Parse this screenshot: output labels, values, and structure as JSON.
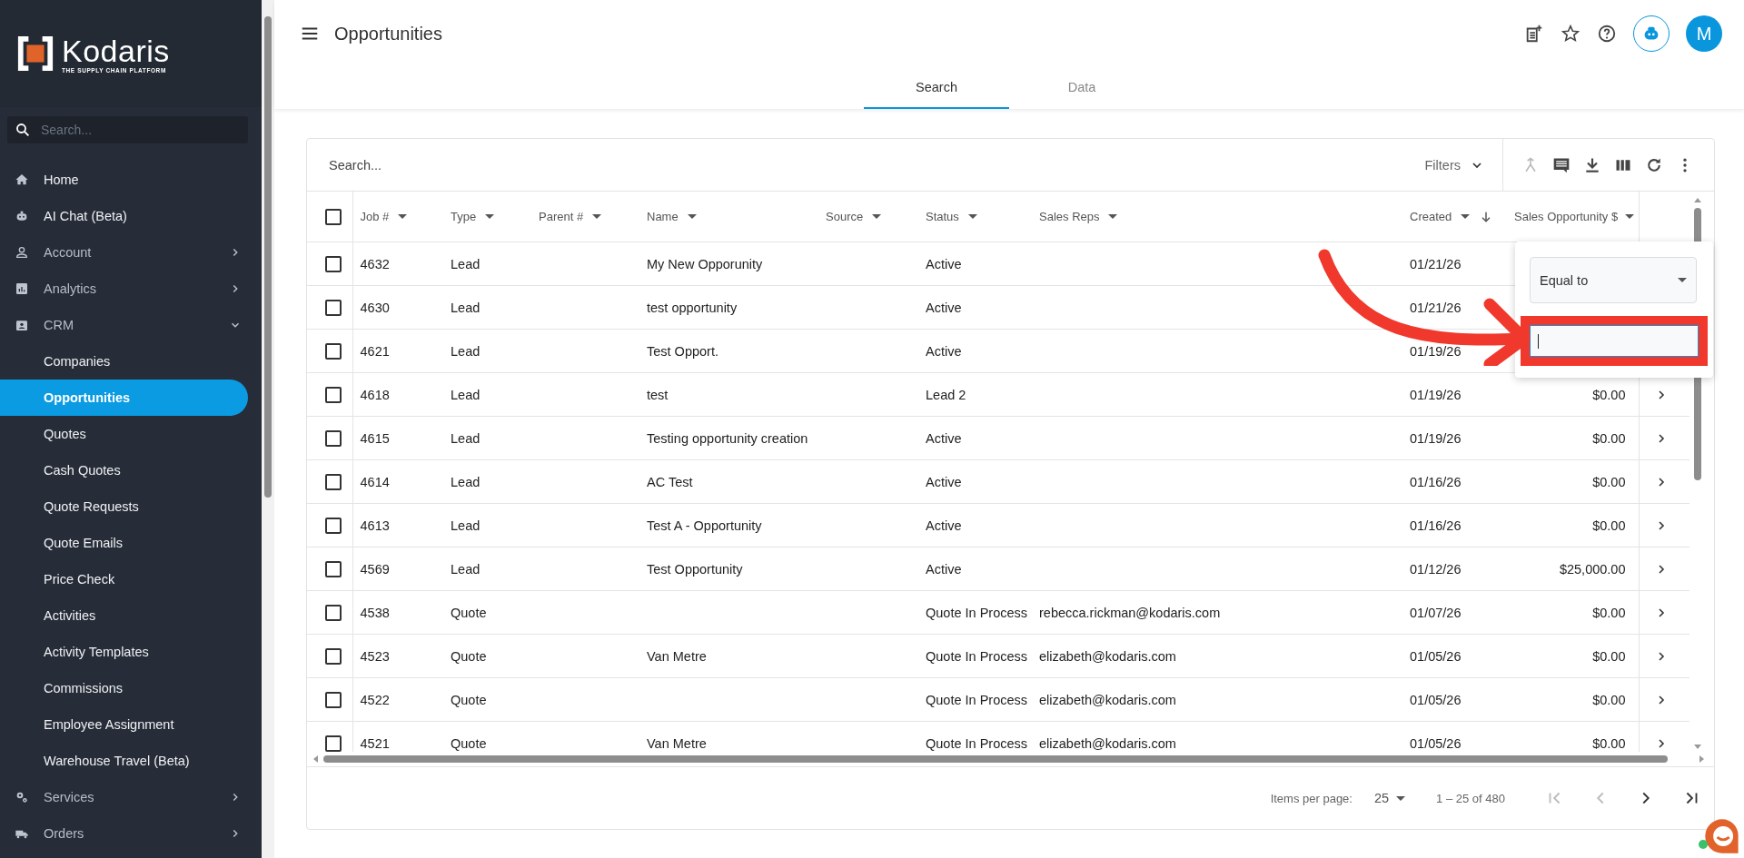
{
  "sidebar": {
    "logo": {
      "name": "Kodaris",
      "tagline": "THE SUPPLY CHAIN PLATFORM"
    },
    "search": {
      "placeholder": "Search..."
    },
    "items": [
      {
        "label": "Home",
        "selected": false
      },
      {
        "label": "AI Chat (Beta)",
        "selected": false
      },
      {
        "label": "Account",
        "selected": false,
        "expanded": false
      },
      {
        "label": "Analytics",
        "selected": false,
        "expanded": false
      },
      {
        "label": "CRM",
        "selected": false,
        "expanded": true,
        "children": [
          {
            "label": "Companies",
            "selected": false
          },
          {
            "label": "Opportunities",
            "selected": true
          },
          {
            "label": "Quotes",
            "selected": false
          },
          {
            "label": "Cash Quotes",
            "selected": false
          },
          {
            "label": "Quote Requests",
            "selected": false
          },
          {
            "label": "Quote Emails",
            "selected": false
          },
          {
            "label": "Price Check",
            "selected": false
          },
          {
            "label": "Activities",
            "selected": false
          },
          {
            "label": "Activity Templates",
            "selected": false
          },
          {
            "label": "Commissions",
            "selected": false
          },
          {
            "label": "Employee Assignment",
            "selected": false
          },
          {
            "label": "Warehouse Travel (Beta)",
            "selected": false
          }
        ]
      },
      {
        "label": "Services",
        "selected": false,
        "expanded": false
      },
      {
        "label": "Orders",
        "selected": false,
        "expanded": false
      }
    ]
  },
  "header": {
    "title": "Opportunities",
    "avatar": "M"
  },
  "tabs": [
    {
      "label": "Search",
      "selected": true
    },
    {
      "label": "Data",
      "selected": false
    }
  ],
  "table": {
    "search": {
      "placeholder": "Search..."
    },
    "filters_label": "Filters",
    "all_checked": false,
    "columns": [
      {
        "label": "Job #"
      },
      {
        "label": "Type"
      },
      {
        "label": "Parent #"
      },
      {
        "label": "Name"
      },
      {
        "label": "Source"
      },
      {
        "label": "Status"
      },
      {
        "label": "Sales Reps"
      },
      {
        "label": "Created",
        "sorted_descending": true
      },
      {
        "label": "Sales Opportunity $"
      }
    ],
    "rows": [
      {
        "checked": false,
        "job": "4632",
        "type": "Lead",
        "name": "My New Opporunity",
        "status": "Active",
        "created": "01/21/26"
      },
      {
        "checked": false,
        "job": "4630",
        "type": "Lead",
        "name": "test opportunity",
        "status": "Active",
        "created": "01/21/26"
      },
      {
        "checked": false,
        "job": "4621",
        "type": "Lead",
        "name": "Test Opport.",
        "status": "Active",
        "created": "01/19/26"
      },
      {
        "checked": false,
        "job": "4618",
        "type": "Lead",
        "name": "test",
        "status": "Lead 2",
        "created": "01/19/26",
        "amount": "$0.00"
      },
      {
        "checked": false,
        "job": "4615",
        "type": "Lead",
        "name": "Testing opportunity creation",
        "status": "Active",
        "created": "01/19/26",
        "amount": "$0.00"
      },
      {
        "checked": false,
        "job": "4614",
        "type": "Lead",
        "name": "AC Test",
        "status": "Active",
        "created": "01/16/26",
        "amount": "$0.00"
      },
      {
        "checked": false,
        "job": "4613",
        "type": "Lead",
        "name": "Test A - Opportunity",
        "status": "Active",
        "created": "01/16/26",
        "amount": "$0.00"
      },
      {
        "checked": false,
        "job": "4569",
        "type": "Lead",
        "name": "Test Opportunity",
        "status": "Active",
        "created": "01/12/26",
        "amount": "$25,000.00"
      },
      {
        "checked": false,
        "job": "4538",
        "type": "Quote",
        "status": "Quote In Process",
        "reps": "rebecca.rickman@kodaris.com",
        "created": "01/07/26",
        "amount": "$0.00"
      },
      {
        "checked": false,
        "job": "4523",
        "type": "Quote",
        "name": "Van Metre",
        "status": "Quote In Process",
        "reps": "elizabeth@kodaris.com",
        "created": "01/05/26",
        "amount": "$0.00"
      },
      {
        "checked": false,
        "job": "4522",
        "type": "Quote",
        "status": "Quote In Process",
        "reps": "elizabeth@kodaris.com",
        "created": "01/05/26",
        "amount": "$0.00"
      },
      {
        "checked": false,
        "job": "4521",
        "type": "Quote",
        "name": "Van Metre",
        "status": "Quote In Process",
        "reps": "elizabeth@kodaris.com",
        "created": "01/05/26",
        "amount": "$0.00"
      }
    ],
    "filter_popup": {
      "operator": "Equal to"
    },
    "pager": {
      "items_label": "Items per page:",
      "page_size": "25",
      "range": "1 – 25 of 480",
      "first_disabled": true,
      "prev_disabled": true
    }
  }
}
